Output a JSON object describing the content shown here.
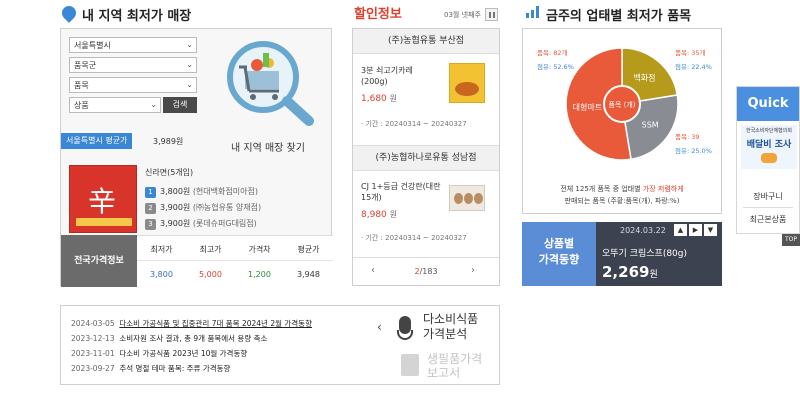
{
  "left": {
    "title": "내 지역 최저가 매장",
    "selects": [
      "서울특별시",
      "품목군",
      "품목",
      "상품"
    ],
    "search_label": "검색",
    "find_label": "내 지역 매장 찾기",
    "avg_badge": "서울특별시 평균가",
    "avg_value": "3,989원",
    "product_name": "신라면(5개입)",
    "product_pkg_text": "辛",
    "ranks": [
      {
        "num": "1",
        "price": "3,800원",
        "store": "(현대백화점미아점)"
      },
      {
        "num": "2",
        "price": "3,900원",
        "store": "(㈜농협유통 양재점)"
      },
      {
        "num": "3",
        "price": "3,900원",
        "store": "(롯데슈퍼G대림점)"
      }
    ],
    "national_label": "전국가격정보",
    "table_headers": [
      "최저가",
      "최고가",
      "가격차",
      "평균가"
    ],
    "table_values": [
      "3,800",
      "5,000",
      "1,200",
      "3,948"
    ],
    "colors": {
      "min": "#2f6fc3",
      "max": "#e0402c",
      "diff": "#2e8b3c",
      "avg": "#333333"
    }
  },
  "middle": {
    "logo": "할인정보",
    "week": "03월 넷째주",
    "pause_icon": "pause-icon",
    "stores": [
      {
        "name": "(주)농협유통 부산점",
        "item": "3분 쇠고기카레\n(200g)",
        "price": "1,680",
        "unit": "원",
        "period": "· 기간 : 20240314 ~ 20240327"
      },
      {
        "name": "(주)농협하나로유통 성남점",
        "item": "CJ 1+등급 건강란(대란 15개)",
        "price": "8,980",
        "unit": "원",
        "period": "· 기간 : 20240314 ~ 20240327"
      }
    ],
    "pager": {
      "current": "2",
      "total": "/183"
    }
  },
  "news": {
    "items": [
      {
        "date": "2024-03-05",
        "text": "다소비 가공식품 및 집중관리 7대 품목 2024년 2월 가격동향"
      },
      {
        "date": "2023-12-13",
        "text": "소비자원 조사 결과, 총 9개 품목에서 용량 축소"
      },
      {
        "date": "2023-11-01",
        "text": "다소비 가공식품 2023년 10월 가격동향"
      },
      {
        "date": "2023-09-27",
        "text": "추석 명절 테마 품목: 주류 가격동향"
      }
    ],
    "analysis_label_1": "다소비식품",
    "analysis_label_2": "가격분석",
    "daily_label_1": "생필품가격",
    "daily_label_2": "보고서"
  },
  "right": {
    "title": "금주의 업태별 최저가 품목",
    "chart_data": {
      "type": "pie",
      "title": "품목 (개)",
      "slices": [
        {
          "name": "대형마트",
          "value": 82,
          "share": "52.6%",
          "color": "#e85a3a"
        },
        {
          "name": "백화점",
          "value": 35,
          "share": "22.4%",
          "color": "#b59a1c"
        },
        {
          "name": "SSM",
          "value": 39,
          "share": "25.0%",
          "color": "#8a8c93"
        }
      ],
      "labels": [
        {
          "count": "품목: 82개",
          "share": "점유: 52.6%"
        },
        {
          "count": "품목: 35개",
          "share": "점유: 22.4%"
        },
        {
          "count": "품목: 39",
          "share": "점유: 25.0%"
        }
      ]
    },
    "summary_pre": "전체 125개 품목 중 업태별",
    "summary_highlight": "가장 저렴하게",
    "summary_line2": "판매되는 품목 (주황:품목(개), 파랑:%)",
    "trend_label_1": "상품별",
    "trend_label_2": "가격동향",
    "trend_date": "2024.03.22",
    "trend_product": "오뚜기 크림스프(80g)",
    "trend_price": "2,269",
    "trend_unit": "원"
  },
  "quick": {
    "title": "Quick",
    "banner_top": "한국소비자단체협의회",
    "banner_main": "배달비 조사",
    "links": [
      "장바구니",
      "최근본상품"
    ],
    "top": "TOP"
  }
}
